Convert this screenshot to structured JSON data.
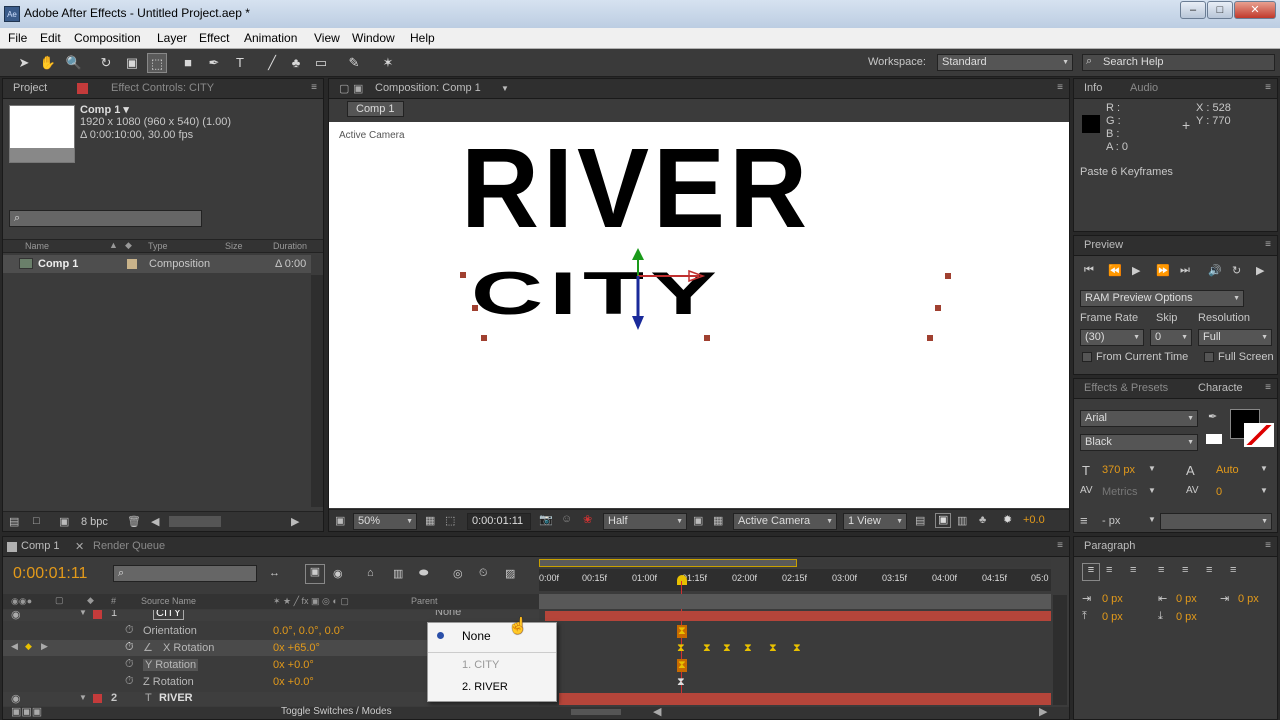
{
  "window": {
    "title": "Adobe After Effects - Untitled Project.aep *",
    "app_icon": "Ae",
    "minimize": "‒",
    "maximize": "□",
    "close": "✕"
  },
  "menu": [
    "File",
    "Edit",
    "Composition",
    "Layer",
    "Effect",
    "Animation",
    "View",
    "Window",
    "Help"
  ],
  "toolbar": {
    "workspace_label": "Workspace:",
    "workspace_value": "Standard",
    "search_help": "Search Help"
  },
  "project_panel": {
    "tab_project": "Project",
    "tab_effect_controls": "Effect Controls: CITY",
    "comp_name": "Comp 1 ▾",
    "comp_info1": "1920 x 1080  (960 x 540) (1.00)",
    "comp_info2": "Δ 0:00:10:00, 30.00 fps",
    "col_name": "Name",
    "col_type": "Type",
    "col_size": "Size",
    "col_duration": "Duration",
    "item_name": "Comp 1",
    "item_type": "Composition",
    "item_duration": "Δ 0:00",
    "bpc": "8 bpc"
  },
  "composition": {
    "tab": "Composition: Comp 1",
    "breadcrumb": "Comp 1",
    "camera_label": "Active Camera",
    "text_top": "RIVER",
    "text_bottom": "CITY",
    "zoom": "50%",
    "timecode": "0:00:01:11",
    "resolution": "Half",
    "camera": "Active Camera",
    "view": "1 View",
    "exposure": "+0.0"
  },
  "info": {
    "tab_info": "Info",
    "tab_audio": "Audio",
    "r": "R :",
    "g": "G :",
    "b": "B :",
    "a": "A : 0",
    "x": "X : 528",
    "y": "Y : 770",
    "message": "Paste 6 Keyframes"
  },
  "preview": {
    "tab": "Preview",
    "ram_options": "RAM Preview Options",
    "frame_rate_label": "Frame Rate",
    "skip_label": "Skip",
    "resolution_label": "Resolution",
    "frame_rate": "(30)",
    "skip": "0",
    "resolution": "Full",
    "from_current": "From Current Time",
    "full_screen": "Full Screen"
  },
  "character": {
    "tab_effects": "Effects & Presets",
    "tab_character": "Characte",
    "font": "Arial",
    "style": "Black",
    "size": "370 px",
    "leading": "Auto",
    "kerning": "Metrics",
    "tracking": "0",
    "indent": "- px"
  },
  "paragraph": {
    "tab": "Paragraph",
    "v1": "0 px",
    "v2": "0 px",
    "v3": "0 px",
    "v4": "0 px",
    "v5": "0 px"
  },
  "timeline": {
    "tab_comp": "Comp 1",
    "tab_render": "Render Queue",
    "timecode": "0:00:01:11",
    "col_source": "Source Name",
    "col_parent": "Parent",
    "ruler": [
      "0:00f",
      "00:15f",
      "01:00f",
      "01:15f",
      "02:00f",
      "02:15f",
      "03:00f",
      "03:15f",
      "04:00f",
      "04:15f",
      "05:0"
    ],
    "layer1_num": "1",
    "layer1_name": "CITY",
    "layer1_parent": "None",
    "layer2_num": "2",
    "layer2_name": "RIVER",
    "props": [
      {
        "name": "Orientation",
        "value": "0.0°, 0.0°, 0.0°"
      },
      {
        "name": "X Rotation",
        "value": "0x +65.0°"
      },
      {
        "name": "Y Rotation",
        "value": "0x +0.0°"
      },
      {
        "name": "Z Rotation",
        "value": "0x +0.0°"
      }
    ],
    "toggle": "Toggle Switches / Modes"
  },
  "parent_menu": {
    "none": "None",
    "city": "1. CITY",
    "river": "2. RIVER"
  },
  "colors": {
    "accent": "#e39a1a",
    "keyframe": "#e8c000",
    "layer_bar": "#b5453a",
    "label_red": "#c43b3b"
  }
}
